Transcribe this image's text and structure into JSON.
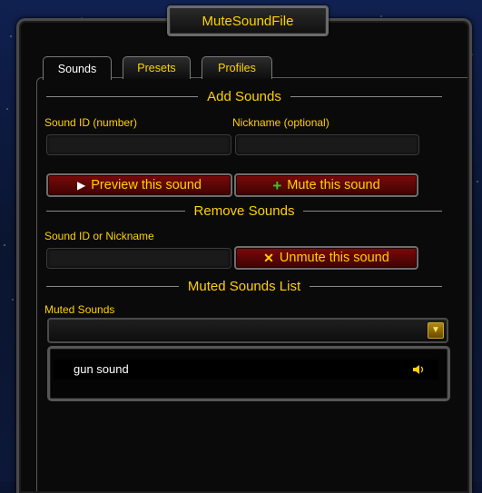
{
  "window": {
    "title": "MuteSoundFile"
  },
  "tabs": [
    {
      "label": "Sounds",
      "active": true
    },
    {
      "label": "Presets",
      "active": false
    },
    {
      "label": "Profiles",
      "active": false
    }
  ],
  "add_sounds": {
    "header": "Add Sounds",
    "sound_id_label": "Sound ID (number)",
    "sound_id_value": "",
    "nickname_label": "Nickname (optional)",
    "nickname_value": "",
    "preview_label": "Preview this sound",
    "preview_icon": "play-icon",
    "mute_label": "Mute this sound",
    "mute_icon": "plus-icon"
  },
  "remove_sounds": {
    "header": "Remove Sounds",
    "field_label": "Sound ID or Nickname",
    "field_value": "",
    "unmute_label": "Unmute this sound",
    "unmute_icon": "x-icon"
  },
  "muted_list": {
    "header": "Muted Sounds List",
    "dropdown_label": "Muted Sounds",
    "dropdown_value": "",
    "items": [
      {
        "name": "gun sound",
        "icon": "speaker-icon"
      }
    ]
  },
  "colors": {
    "accent_gold": "#ffd100",
    "button_red": "#6a0808",
    "plus_green": "#2ecc2e",
    "x_gold": "#ffd100"
  }
}
